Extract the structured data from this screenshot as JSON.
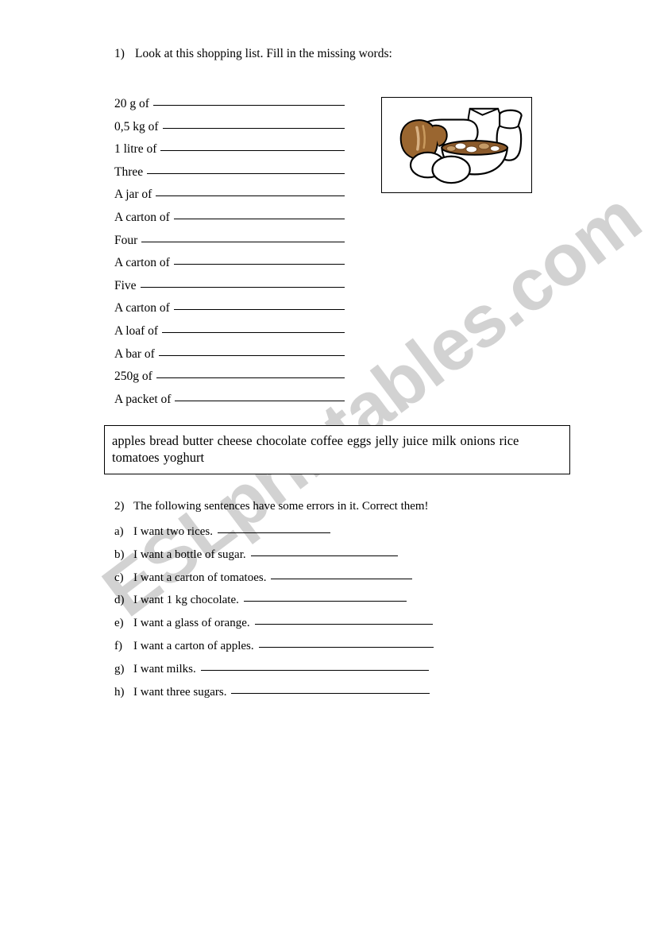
{
  "watermark": {
    "text": "ESLprintables.com"
  },
  "exercise1": {
    "number": "1)",
    "instruction": "Look at this shopping list. Fill in the missing words:",
    "items": [
      {
        "label": "20 g of",
        "blank_width": 196
      },
      {
        "label": "0,5 kg of",
        "blank_width": 196
      },
      {
        "label": "1 litre of",
        "blank_width": 196
      },
      {
        "label": "Three",
        "blank_width": 196
      },
      {
        "label": "A jar of",
        "blank_width": 196
      },
      {
        "label": "A carton of",
        "blank_width": 196
      },
      {
        "label": "Four",
        "blank_width": 196
      },
      {
        "label": "A carton of",
        "blank_width": 196
      },
      {
        "label": "Five",
        "blank_width": 196
      },
      {
        "label": "A carton of",
        "blank_width": 196
      },
      {
        "label": "A loaf of",
        "blank_width": 196
      },
      {
        "label": "A bar of",
        "blank_width": 196
      },
      {
        "label": "250g of",
        "blank_width": 196
      },
      {
        "label": "A packet of",
        "blank_width": 196
      }
    ],
    "clipart": {
      "name": "breakfast-foods-clipart",
      "description": "Breakfast foods: brown bread loaf, white bread, bowl of cereal, eggs, bag and jug of milk",
      "colors": {
        "bread_brown": "#9a6630",
        "bread_highlight": "#c99a5e",
        "cereal_brown": "#8b5a2b",
        "outline": "#000000",
        "fill": "#ffffff"
      }
    }
  },
  "word_bank": {
    "words": "apples bread butter cheese chocolate coffee eggs jelly juice milk onions rice tomatoes yoghurt"
  },
  "exercise2": {
    "number": "2)",
    "instruction": "The following sentences have some errors in it. Correct them!",
    "items": [
      {
        "marker": "a)",
        "sentence": "I want two rices.",
        "blank_width": 142
      },
      {
        "marker": "b)",
        "sentence": "I want a bottle of sugar.",
        "blank_width": 185
      },
      {
        "marker": "c)",
        "sentence": "I want a carton of tomatoes.",
        "blank_width": 178
      },
      {
        "marker": "d)",
        "sentence": "I want 1 kg chocolate.",
        "blank_width": 205
      },
      {
        "marker": "e)",
        "sentence": "I want a glass of orange.",
        "blank_width": 224
      },
      {
        "marker": "f)",
        "sentence": "I want a carton of apples.",
        "blank_width": 220
      },
      {
        "marker": "g)",
        "sentence": "I want milks.",
        "blank_width": 287
      },
      {
        "marker": "h)",
        "sentence": "I want three sugars.",
        "blank_width": 250
      }
    ]
  }
}
